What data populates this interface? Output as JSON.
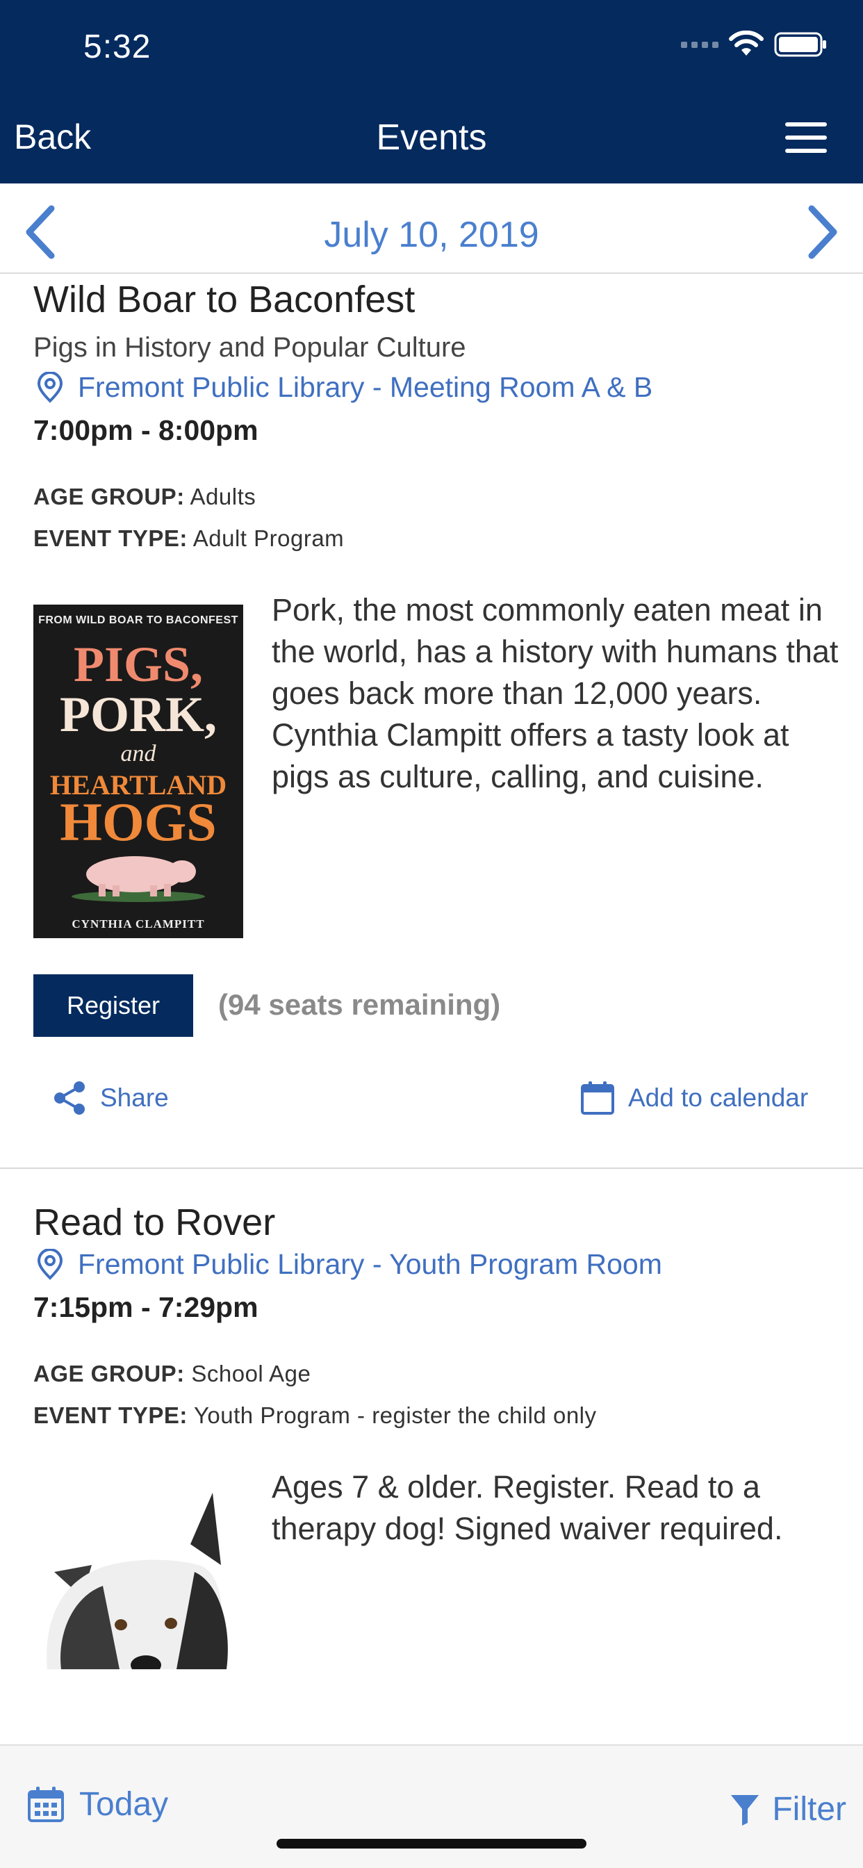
{
  "status_bar": {
    "time": "5:32"
  },
  "nav": {
    "back_label": "Back",
    "title": "Events",
    "menu_icon": "hamburger-icon"
  },
  "date_bar": {
    "date": "July 10, 2019",
    "prev_icon": "chevron-left-icon",
    "next_icon": "chevron-right-icon"
  },
  "colors": {
    "header_bg": "#042a5e",
    "accent": "#4a7fce",
    "link": "#3f6fc0",
    "seats_text": "#8a8a8a"
  },
  "events": [
    {
      "title": "Wild Boar to Baconfest",
      "subtitle": "Pigs in History and Popular Culture",
      "location": "Fremont Public Library - Meeting Room A & B",
      "time": "7:00pm - 8:00pm",
      "age_group_label": "AGE GROUP:",
      "age_group": "Adults",
      "event_type_label": "EVENT TYPE:",
      "event_type": "Adult Program",
      "description": "Pork, the most commonly eaten meat in the world, has a history with humans that goes back more than 12,000 years. Cynthia Clampitt offers a tasty look at pigs as culture, calling, and cuisine.",
      "image": {
        "top_line": "FROM WILD BOAR TO BACONFEST",
        "line1": "PIGS,",
        "line2": "PORK,",
        "line3": "and",
        "line4": "HEARTLAND",
        "line5": "HOGS",
        "author": "CYNTHIA CLAMPITT"
      },
      "register_label": "Register",
      "seats": "(94 seats remaining)",
      "share_label": "Share",
      "calendar_label": "Add to calendar"
    },
    {
      "title": "Read to Rover",
      "location": "Fremont Public Library - Youth Program Room",
      "time": "7:15pm - 7:29pm",
      "age_group_label": "AGE GROUP:",
      "age_group": "School Age",
      "event_type_label": "EVENT TYPE:",
      "event_type": "Youth Program - register the child only",
      "description": "Ages 7 & older. Register. Read to a therapy dog! Signed waiver required."
    }
  ],
  "bottom_bar": {
    "today_label": "Today",
    "filter_label": "Filter"
  }
}
